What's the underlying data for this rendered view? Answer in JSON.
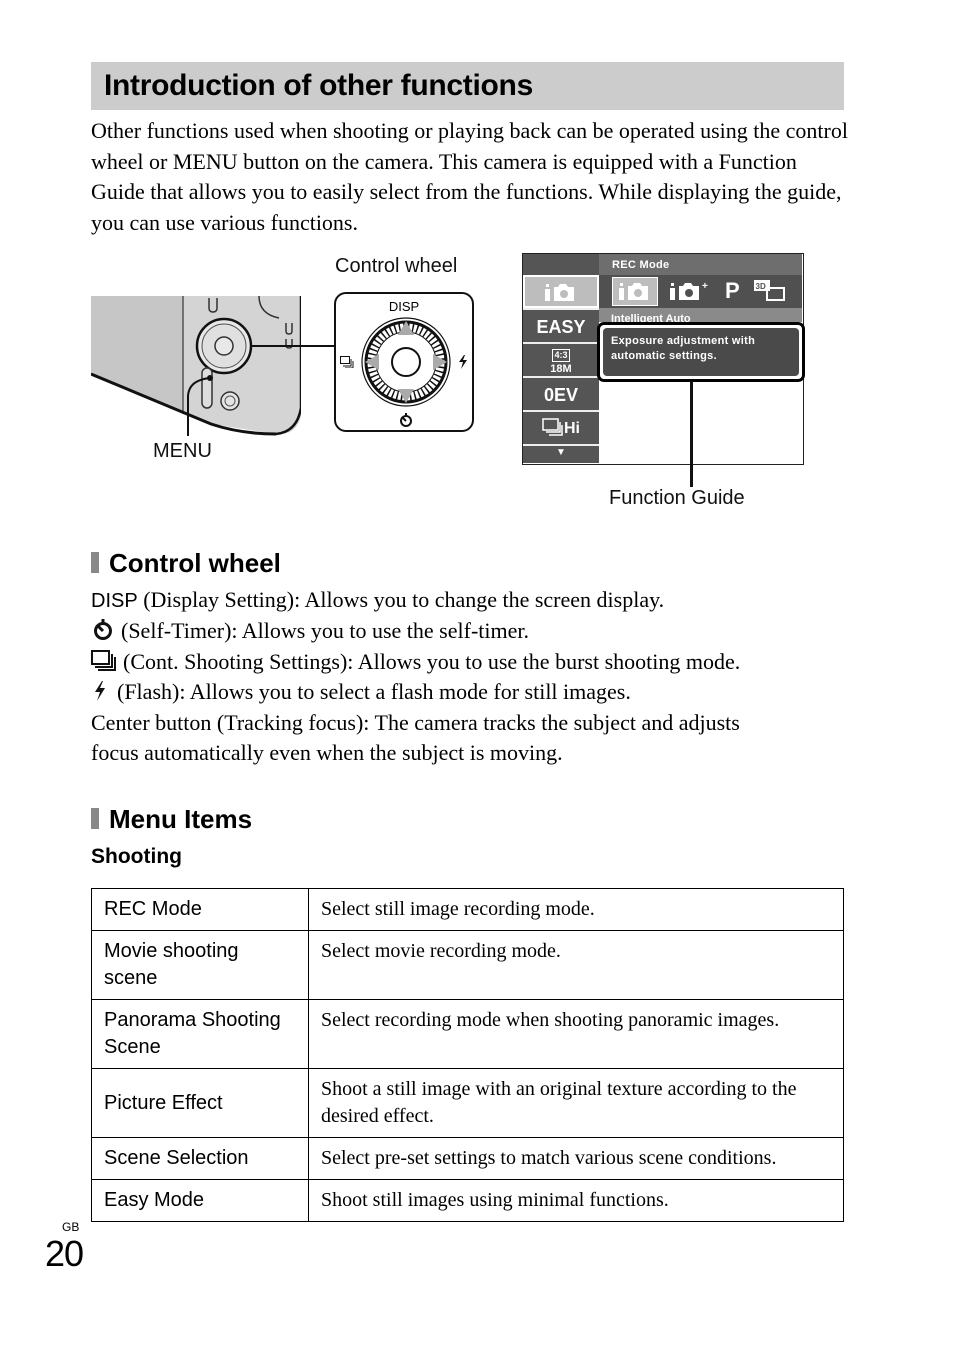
{
  "page": {
    "title": "Introduction of other functions",
    "intro": "Other functions used when shooting or playing back can be operated using the control wheel or MENU button on the camera. This camera is equipped with a Function Guide that allows you to easily select from the functions. While displaying the guide, you can use various functions.",
    "language_code": "GB",
    "page_number": "20"
  },
  "figure": {
    "control_wheel_label": "Control wheel",
    "menu_label": "MENU",
    "function_guide_label": "Function Guide",
    "wheel": {
      "top_label": "DISP",
      "left_icon": "cont-shooting-icon",
      "right_icon": "flash-icon",
      "bottom_icon": "self-timer-icon"
    },
    "screen": {
      "header": "REC Mode",
      "left_menu": [
        {
          "label": "iO",
          "icon": "intelligent-auto-icon",
          "selected": true
        },
        {
          "label": "EASY",
          "selected": false
        },
        {
          "label_top": "4:3",
          "label_bottom": "18M",
          "icon": "image-size-icon",
          "selected": false
        },
        {
          "label": "0EV",
          "selected": false
        },
        {
          "label": "Hi",
          "icon": "burst-hi-icon",
          "selected": false
        },
        {
          "label": "▼",
          "icon": "scroll-down-icon",
          "selected": false
        }
      ],
      "modes": [
        {
          "name": "intelligent-auto",
          "selected": true
        },
        {
          "name": "superior-auto",
          "selected": false
        },
        {
          "name": "P",
          "selected": false
        },
        {
          "name": "3D",
          "selected": false
        }
      ],
      "mode_name": "Intelligent Auto",
      "guide_text_1": "Exposure adjustment with",
      "guide_text_2": "automatic settings."
    }
  },
  "control_wheel": {
    "heading": "Control wheel",
    "items": [
      {
        "prefix": "DISP",
        "text": " (Display Setting): Allows you to change the screen display."
      },
      {
        "icon": "self-timer-icon",
        "text": "(Self-Timer): Allows you to use the self-timer."
      },
      {
        "icon": "cont-shooting-icon",
        "text": "(Cont. Shooting Settings): Allows you to use the burst shooting mode."
      },
      {
        "icon": "flash-icon",
        "text": "(Flash): Allows you to select a flash mode for still images."
      }
    ],
    "center_line_1": "Center button (Tracking focus): The camera tracks the subject and adjusts",
    "center_line_2": "focus automatically even when the subject is moving."
  },
  "menu_items": {
    "heading": "Menu Items",
    "subheading": "Shooting",
    "rows": [
      {
        "item": "REC Mode",
        "desc": "Select still image recording mode."
      },
      {
        "item": "Movie shooting scene",
        "desc": "Select movie recording mode."
      },
      {
        "item": "Panorama Shooting Scene",
        "desc": "Select recording mode when shooting panoramic images."
      },
      {
        "item": "Picture Effect",
        "desc": "Shoot a still image with an original texture according to the desired effect."
      },
      {
        "item": "Scene Selection",
        "desc": "Select pre-set settings to match various scene conditions."
      },
      {
        "item": "Easy Mode",
        "desc": "Shoot still images using minimal functions."
      }
    ]
  }
}
